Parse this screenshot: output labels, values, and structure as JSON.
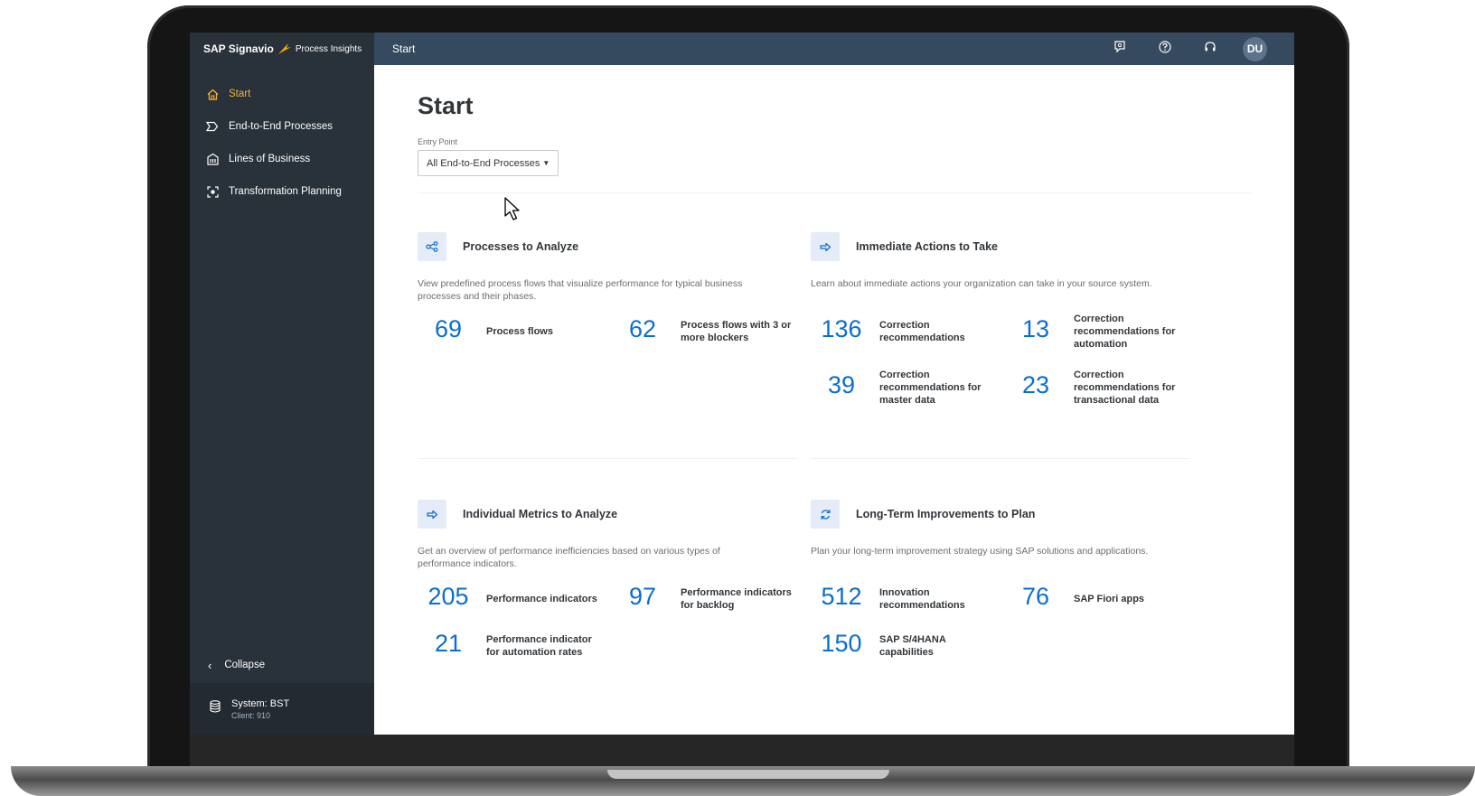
{
  "shell": {
    "brand": "SAP Signavio",
    "product": "Process Insights",
    "title": "Start",
    "avatar_initials": "DU",
    "icons": [
      "feedback-icon",
      "help-icon",
      "support-icon"
    ]
  },
  "sidebar": {
    "items": [
      {
        "label": "Start",
        "icon": "home-icon",
        "active": true
      },
      {
        "label": "End-to-End Processes",
        "icon": "process-icon",
        "active": false
      },
      {
        "label": "Lines of Business",
        "icon": "building-icon",
        "active": false
      },
      {
        "label": "Transformation Planning",
        "icon": "target-icon",
        "active": false
      }
    ],
    "collapse_label": "Collapse",
    "system_name": "System: BST",
    "system_client": "Client: 910"
  },
  "main": {
    "title": "Start",
    "entry_point_label": "Entry Point",
    "entry_point_value": "All End-to-End Processes",
    "cards": [
      {
        "title": "Processes to Analyze",
        "icon": "process-flow-icon",
        "description": "View predefined process flows that visualize performance for typical business processes and their phases.",
        "metrics": [
          {
            "value": "69",
            "label": "Process flows"
          },
          {
            "value": "62",
            "label": "Process flows with 3 or more blockers"
          }
        ]
      },
      {
        "title": "Immediate Actions to Take",
        "icon": "arrow-right-icon",
        "description": "Learn about immediate actions your organization can take in your source system.",
        "metrics": [
          {
            "value": "136",
            "label": "Correction recommendations"
          },
          {
            "value": "13",
            "label": "Correction recommendations for automation"
          },
          {
            "value": "39",
            "label": "Correction recommendations for master data"
          },
          {
            "value": "23",
            "label": "Correction recommendations for transactional data"
          }
        ]
      },
      {
        "title": "Individual Metrics to Analyze",
        "icon": "arrow-right-icon",
        "description": "Get an overview of performance inefficiencies based on various types of performance indicators.",
        "metrics": [
          {
            "value": "205",
            "label": "Performance indicators"
          },
          {
            "value": "97",
            "label": "Performance indicators for backlog"
          },
          {
            "value": "21",
            "label": "Performance indicator for automation rates"
          }
        ]
      },
      {
        "title": "Long-Term Improvements to Plan",
        "icon": "refresh-icon",
        "description": "Plan your long-term improvement strategy using SAP solutions and applications.",
        "metrics": [
          {
            "value": "512",
            "label": "Innovation recommendations"
          },
          {
            "value": "76",
            "label": "SAP Fiori apps"
          },
          {
            "value": "150",
            "label": "SAP S/4HANA capabilities"
          }
        ]
      }
    ]
  },
  "colors": {
    "shell": "#354a5f",
    "sidebar": "#29313a",
    "accent": "#0a6ed1",
    "active_nav": "#f5b433",
    "icon_tile": "#e5ecf7"
  }
}
